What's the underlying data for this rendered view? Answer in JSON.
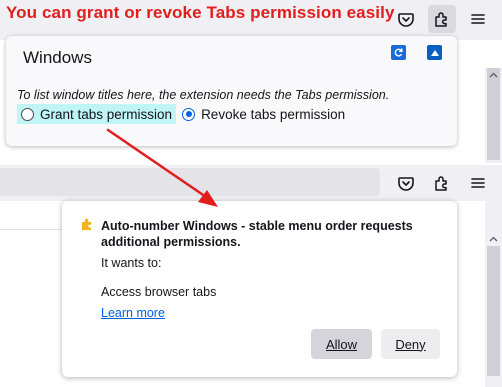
{
  "annotation": {
    "title": "You can grant or revoke Tabs permission easily",
    "color": "#e11d1d"
  },
  "toolbar": {
    "icons": [
      "pocket-icon",
      "extensions-icon",
      "menu-icon"
    ]
  },
  "windows_panel": {
    "title": "Windows",
    "note": "To list window titles here, the extension needs the Tabs permission.",
    "options": [
      {
        "label": "Grant tabs permission",
        "checked": false,
        "highlighted": true
      },
      {
        "label": "Revoke tabs permission",
        "checked": true,
        "highlighted": false
      }
    ],
    "buttons": [
      "refresh-icon",
      "collapse-icon"
    ]
  },
  "permission_popup": {
    "message": "Auto-number Windows - stable menu order requests additional permissions.",
    "wants_label": "It wants to:",
    "permission": "Access browser tabs",
    "learn_more": "Learn more",
    "allow_label": "Allow",
    "deny_label": "Deny"
  },
  "colors": {
    "accent": "#0061e0",
    "highlight": "#bff5f5",
    "arrow": "#e11d1d",
    "extension_icon": "#f2b418"
  }
}
